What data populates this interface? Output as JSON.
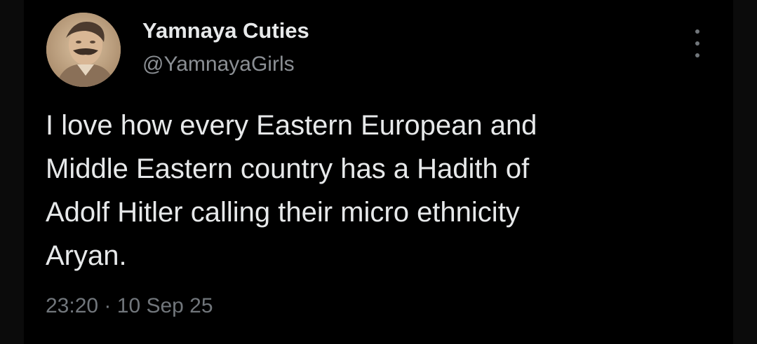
{
  "tweet": {
    "display_name": "Yamnaya Cuties",
    "handle": "@YamnayaGirls",
    "text": "I love how every Eastern European and\nMiddle Eastern country has a Hadith of\nAdolf Hitler calling their micro ethnicity\nAryan.",
    "time": "23:20",
    "separator": "·",
    "date": "10 Sep 25",
    "more_icon": "more-vertical-icon",
    "avatar_icon": "sepia-portrait-avatar"
  },
  "colors": {
    "background": "#000000",
    "primary_text": "#e7e9ea",
    "secondary_text": "#71767b"
  }
}
